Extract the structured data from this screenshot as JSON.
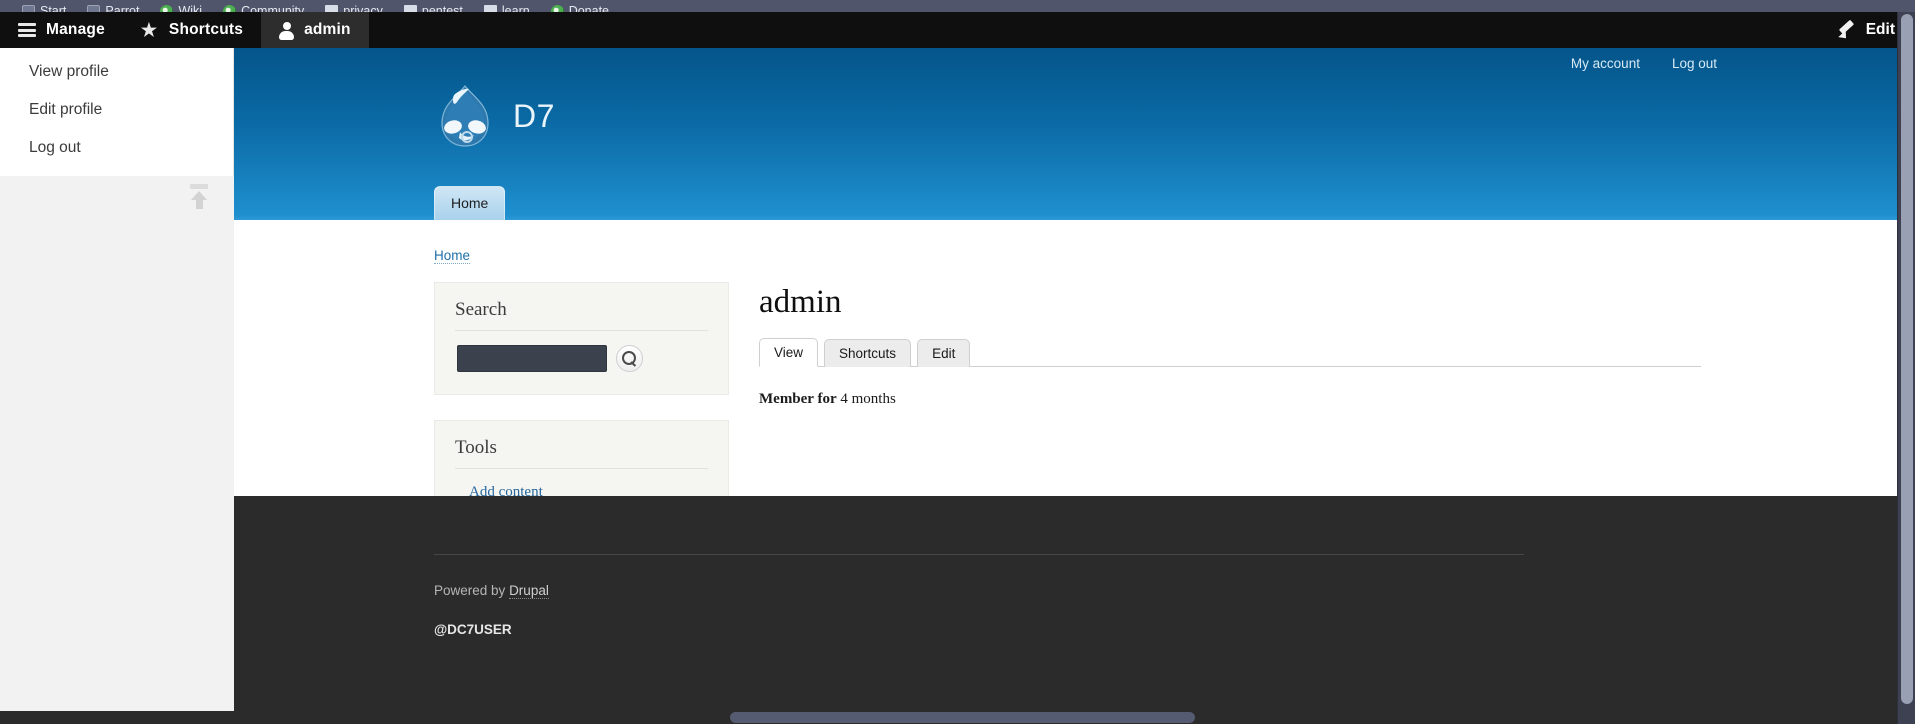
{
  "browser": {
    "bookmarks": [
      {
        "label": "Start",
        "icon": "image-icon"
      },
      {
        "label": "Parrot",
        "icon": "image-icon"
      },
      {
        "label": "Wiki",
        "icon": "melon-icon"
      },
      {
        "label": "Community",
        "icon": "melon-icon"
      },
      {
        "label": "privacy",
        "icon": "folder-icon"
      },
      {
        "label": "pentest",
        "icon": "folder-icon"
      },
      {
        "label": "learn",
        "icon": "folder-icon"
      },
      {
        "label": "Donate",
        "icon": "melon-icon"
      }
    ]
  },
  "toolbar": {
    "manage_label": "Manage",
    "shortcuts_label": "Shortcuts",
    "account_label": "admin",
    "edit_label": "Edit",
    "icons": {
      "manage": "hamburger-icon",
      "shortcuts": "star-icon",
      "account": "person-icon",
      "edit": "pencil-icon"
    }
  },
  "tray": {
    "items": [
      {
        "label": "View profile"
      },
      {
        "label": "Edit profile"
      },
      {
        "label": "Log out"
      }
    ],
    "toggle_icon": "collapse-tray-icon"
  },
  "site": {
    "name": "D7",
    "logo": "drupal-droplet-icon",
    "user_links": [
      {
        "label": "My account"
      },
      {
        "label": "Log out"
      }
    ],
    "main_menu": [
      {
        "label": "Home"
      }
    ],
    "breadcrumb": [
      {
        "label": "Home"
      }
    ]
  },
  "sidebar": {
    "search_block": {
      "title": "Search",
      "input_value": "",
      "input_placeholder": "",
      "submit_icon": "search-icon"
    },
    "tools_block": {
      "title": "Tools",
      "links": [
        {
          "label": "Add content"
        }
      ]
    }
  },
  "main": {
    "title": "admin",
    "tabs": [
      {
        "label": "View",
        "active": true
      },
      {
        "label": "Shortcuts",
        "active": false
      },
      {
        "label": "Edit",
        "active": false
      }
    ],
    "member_label": "Member for",
    "member_value": "4 months"
  },
  "footer": {
    "powered_prefix": "Powered by",
    "powered_link": "Drupal",
    "handle": "@DC7USER"
  },
  "colors": {
    "toolbar_bg": "#0f0f0f",
    "header_top": "#04558a",
    "header_bottom": "#2e9ad6",
    "link_blue": "#1f6fa8",
    "footer_bg": "#2b2b2b",
    "search_input_bg": "#3b414d"
  }
}
